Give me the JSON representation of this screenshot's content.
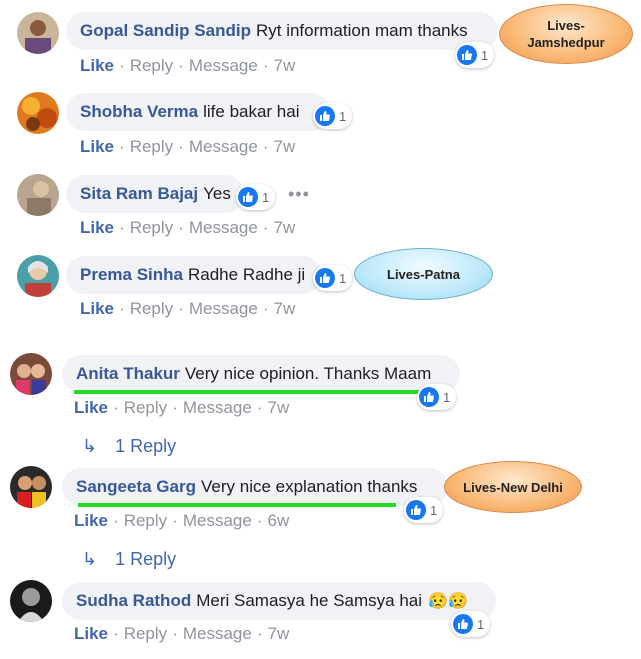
{
  "comments": [
    {
      "author": "Gopal Sandip Sandip",
      "text": "Ryt information mam thanks",
      "reactions": "1",
      "like": "Like",
      "reply": "Reply",
      "message": "Message",
      "time": "7w"
    },
    {
      "author": "Shobha Verma",
      "text": "life bakar hai",
      "reactions": "1",
      "like": "Like",
      "reply": "Reply",
      "message": "Message",
      "time": "7w"
    },
    {
      "author": "Sita Ram Bajaj",
      "text": "Yes",
      "reactions": "1",
      "like": "Like",
      "reply": "Reply",
      "message": "Message",
      "time": "7w",
      "more": "•••"
    },
    {
      "author": "Prema Sinha",
      "text": "Radhe Radhe ji",
      "reactions": "1",
      "like": "Like",
      "reply": "Reply",
      "message": "Message",
      "time": "7w"
    },
    {
      "author": "Anita Thakur",
      "text": "Very nice opinion. Thanks Maam",
      "reactions": "1",
      "like": "Like",
      "reply": "Reply",
      "message": "Message",
      "time": "7w",
      "replies": "1 Reply"
    },
    {
      "author": "Sangeeta Garg",
      "text": "Very nice explanation thanks",
      "reactions": "1",
      "like": "Like",
      "reply": "Reply",
      "message": "Message",
      "time": "6w",
      "replies": "1 Reply"
    },
    {
      "author": "Sudha Rathod",
      "text": "Meri Samasya he Samsya hai",
      "emoji": "😥😥",
      "reactions": "1",
      "like": "Like",
      "reply": "Reply",
      "message": "Message",
      "time": "7w"
    }
  ],
  "callouts": {
    "jamshedpur": "Lives-\nJamshedpur",
    "patna": "Lives-Patna",
    "delhi": "Lives-New Delhi"
  },
  "colors": {
    "author": "#385898",
    "link": "#4267b2",
    "bubble": "#f0f2f5",
    "highlight": "#22dd22"
  },
  "icons": {
    "reaction": "like-icon",
    "reply_arrow": "reply-arrow-icon"
  }
}
